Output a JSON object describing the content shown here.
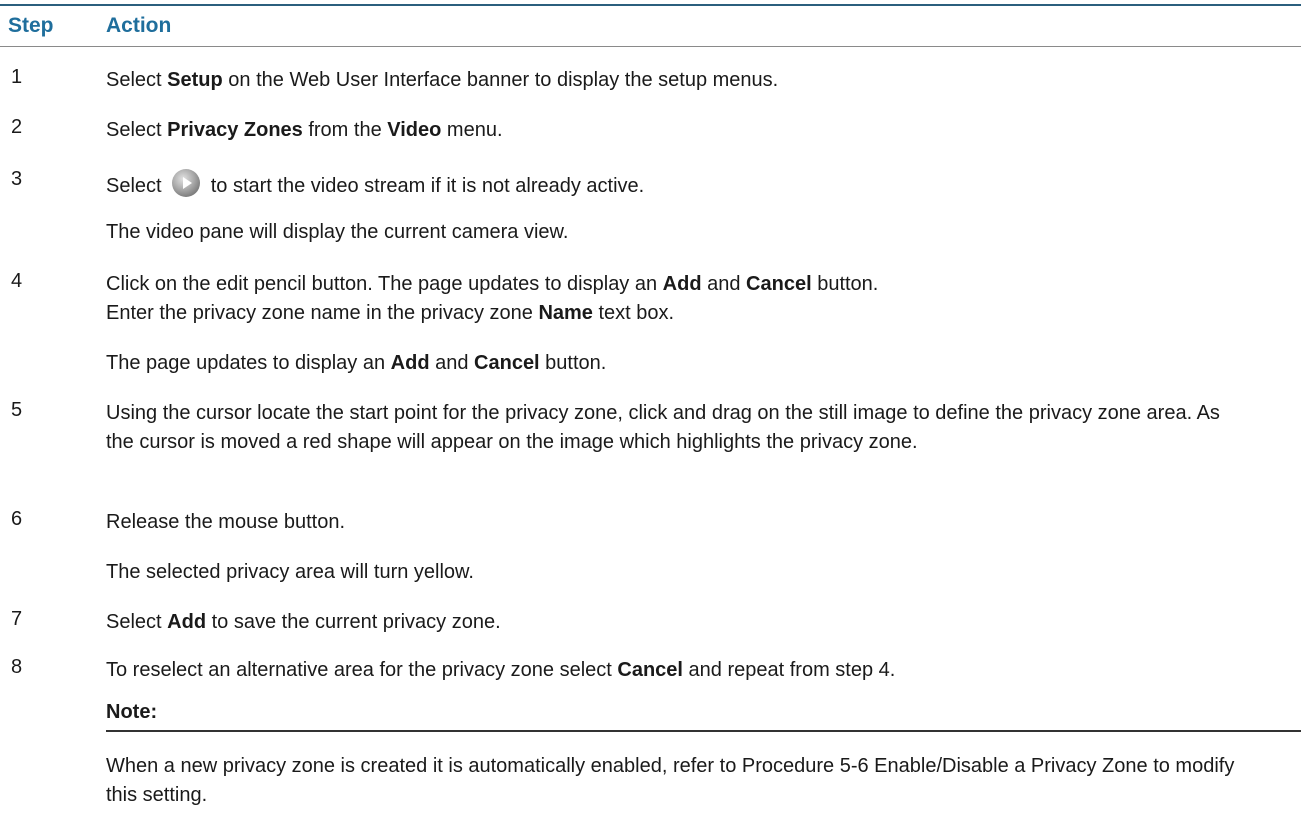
{
  "header": {
    "step": "Step",
    "action": "Action"
  },
  "steps": [
    {
      "num": "1",
      "t1": "Select ",
      "b1": "Setup",
      "t2": " on the Web User Interface banner to display the setup menus."
    },
    {
      "num": "2",
      "t1": "Select ",
      "b1": "Privacy Zones",
      "t2": " from the ",
      "b2": "Video",
      "t3": " menu."
    },
    {
      "num": "3",
      "t1": "Select ",
      "icon": "play-button-icon",
      "t2": " to start the video stream if it is not already active.",
      "sub": "The video pane will display the current camera view."
    },
    {
      "num": "4",
      "t1": "Click on the edit pencil button. The page updates to display an ",
      "b1": "Add",
      "t2": " and ",
      "b2": "Cancel",
      "t3": " button.",
      "line2a": "Enter the privacy zone name in the privacy zone ",
      "line2b": "Name",
      "line2c": " text box.",
      "sub_a": "The page updates to display an ",
      "sub_b": "Add",
      "sub_c": " and ",
      "sub_d": "Cancel",
      "sub_e": " button."
    },
    {
      "num": "5",
      "t1": "Using the cursor locate the start point for the privacy zone, click and drag on the still image to define the privacy zone area. As the cursor is moved a red shape will appear on the image which highlights the privacy zone."
    },
    {
      "num": "6",
      "t1": "Release the mouse button.",
      "sub": "The selected privacy area will turn yellow."
    },
    {
      "num": "7",
      "t1": "Select ",
      "b1": "Add",
      "t2": " to save the current privacy zone."
    },
    {
      "num": "8",
      "t1": "To reselect an alternative area for the privacy zone select ",
      "b1": "Cancel",
      "t2": " and repeat from step 4."
    }
  ],
  "note": {
    "title": "Note:",
    "body": "When a new privacy zone is created it is automatically enabled, refer to Procedure 5-6 Enable/Disable a Privacy Zone to modify this setting."
  },
  "colors": {
    "header_text": "#1f6e9c",
    "top_rule": "#2b5f7e"
  }
}
